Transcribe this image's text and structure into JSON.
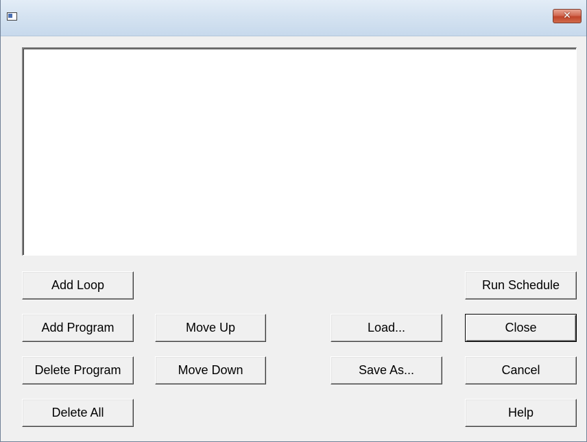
{
  "window": {
    "title": "",
    "icon": "app-window-icon",
    "close_label": "✕"
  },
  "schedule_list": {
    "items": []
  },
  "buttons": {
    "add_loop": "Add Loop",
    "add_program": "Add Program",
    "delete_program": "Delete Program",
    "delete_all": "Delete All",
    "move_up": "Move Up",
    "move_down": "Move Down",
    "load": "Load...",
    "save_as": "Save As...",
    "run_schedule": "Run Schedule",
    "close": "Close",
    "cancel": "Cancel",
    "help": "Help"
  },
  "colors": {
    "titlebar": "#d5e3f1",
    "close_button": "#c0442a",
    "dialog_face": "#f0f0f0"
  }
}
